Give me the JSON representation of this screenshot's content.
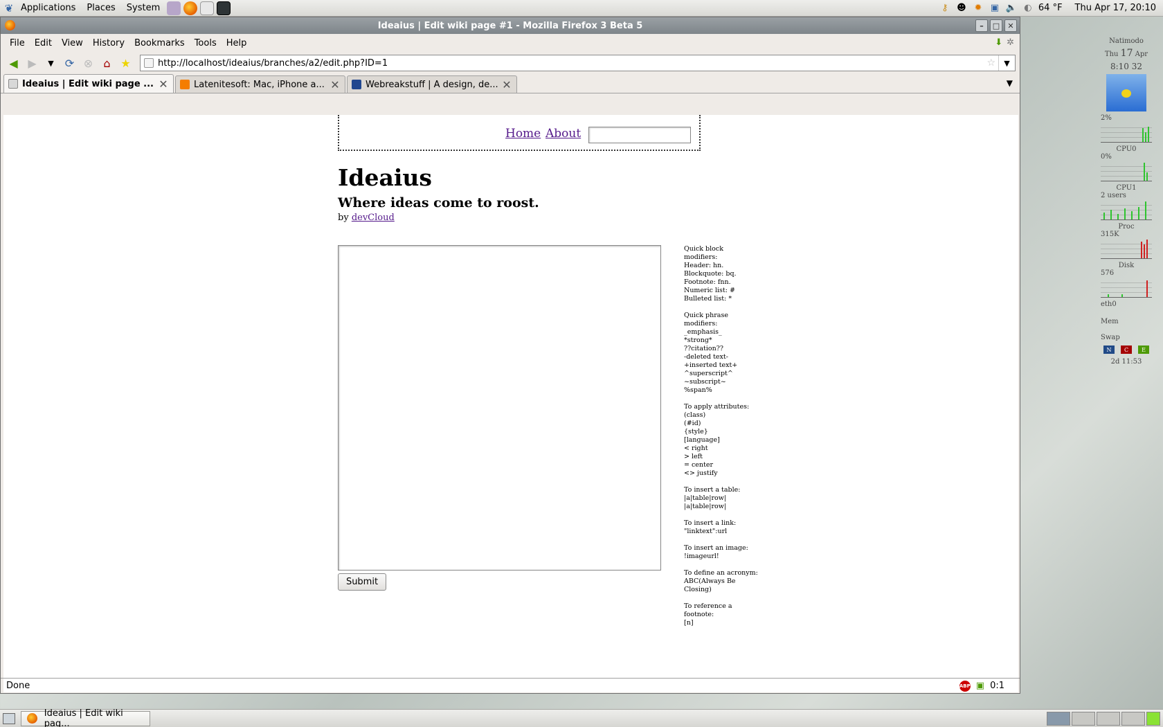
{
  "top_panel": {
    "menus": [
      "Applications",
      "Places",
      "System"
    ],
    "temperature": "64 °F",
    "clock": "Thu Apr 17, 20:10"
  },
  "window": {
    "title": "Ideaius | Edit wiki page #1 - Mozilla Firefox 3 Beta 5",
    "buttons": {
      "minimize": "–",
      "maximize": "□",
      "close": "✕"
    }
  },
  "menubar": [
    "File",
    "Edit",
    "View",
    "History",
    "Bookmarks",
    "Tools",
    "Help"
  ],
  "navbar": {
    "url": "http://localhost/ideaius/branches/a2/edit.php?ID=1"
  },
  "tabs": [
    {
      "label": "Ideaius | Edit wiki page ...",
      "active": true,
      "favicon_color": "#d8d8d8"
    },
    {
      "label": "Latenitesoft: Mac, iPhone a...",
      "active": false,
      "favicon_color": "#f57d00"
    },
    {
      "label": "Webreakstuff | A design, de...",
      "active": false,
      "favicon_color": "#21478f"
    }
  ],
  "page": {
    "nav": {
      "home": "Home",
      "about": "About",
      "search_value": ""
    },
    "title": "Ideaius",
    "tagline": "Where ideas come to roost.",
    "byline_prefix": "by ",
    "byline_link": "devCloud",
    "editor_value": "",
    "submit_label": "Submit",
    "help_blocks": [
      [
        "Quick block",
        "modifiers:",
        "Header: hn.",
        "Blockquote: bq.",
        "Footnote: fnn.",
        "Numeric list: #",
        "Bulleted list: *"
      ],
      [
        "Quick phrase",
        "modifiers:",
        "_emphasis_",
        "*strong*",
        "??citation??",
        "-deleted text-",
        "+inserted text+",
        "^superscript^",
        "~subscript~",
        "%span%"
      ],
      [
        "To apply attributes:",
        "(class)",
        "(#id)",
        "{style}",
        "[language]",
        "< right",
        "> left",
        "= center",
        "<> justify"
      ],
      [
        "To insert a table:",
        "|a|table|row|",
        "|a|table|row|"
      ],
      [
        "To insert a link:",
        "\"linktext\":url"
      ],
      [
        "To insert an image:",
        "!imageurl!"
      ],
      [
        "To define an acronym:",
        "ABC(Always Be",
        "Closing)"
      ],
      [
        "To reference a",
        "footnote:",
        "[n]"
      ]
    ]
  },
  "statusbar": {
    "text": "Done",
    "counter": "0:1",
    "abp": "ABP"
  },
  "gkrellm": {
    "host": "Natimodo",
    "date_day": "Thu",
    "date_num": "17",
    "date_month": "Apr",
    "time": "8:10 32",
    "top_pct": "2%",
    "cpu0": "CPU0",
    "cpu0_pct": "0%",
    "cpu1": "CPU1",
    "cpu1_users": "2 users",
    "proc": "Proc",
    "proc_val": "315K",
    "disk": "Disk",
    "disk_val": "576",
    "eth0": "eth0",
    "mem": "Mem",
    "swap": "Swap",
    "swap_buttons": [
      "N",
      "C",
      "E"
    ],
    "uptime": "2d 11:53"
  },
  "taskbar": {
    "firefox_task": "Ideaius | Edit wiki pag..."
  },
  "colors": {
    "link": "#551a8b",
    "titlebar": "#868c90"
  }
}
